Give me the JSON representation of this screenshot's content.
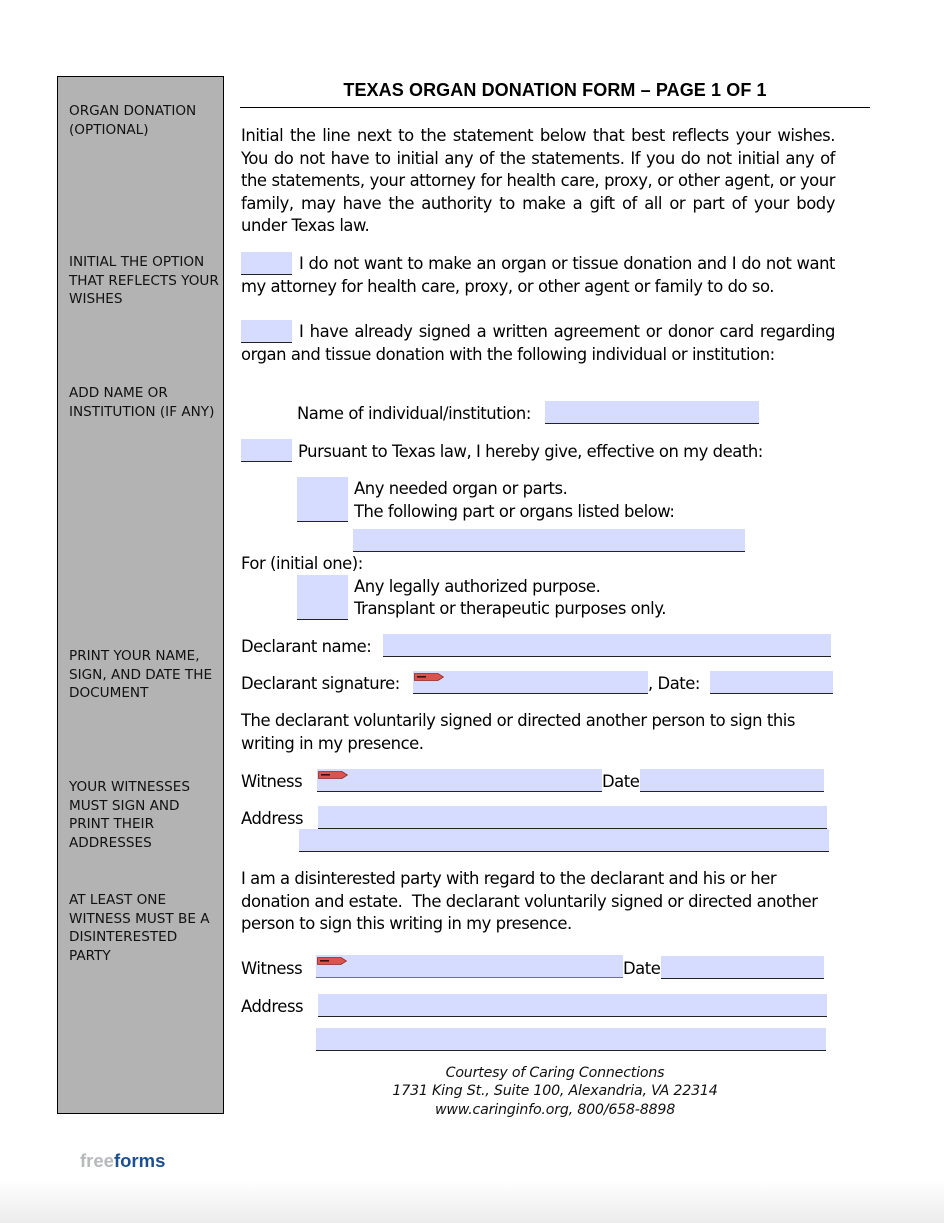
{
  "document": {
    "title": "TEXAS ORGAN DONATION FORM – PAGE 1 OF 1"
  },
  "sidebar": {
    "labels": [
      "ORGAN DONATION (OPTIONAL)",
      "INITIAL THE OPTION THAT REFLECTS YOUR WISHES",
      "ADD NAME OR INSTITUTION (IF ANY)",
      "PRINT YOUR NAME, SIGN, AND DATE THE DOCUMENT",
      "YOUR WITNESSES MUST SIGN AND PRINT THEIR ADDRESSES",
      "AT LEAST ONE WITNESS MUST BE A DISINTERESTED PARTY"
    ]
  },
  "body": {
    "intro": "Initial the line next to the statement below that best reflects your wishes. You do not have to initial any of the statements. If you do not initial any of the statements, your attorney for health care, proxy, or other agent, or your family, may have the authority to make a gift of all or part of your body under Texas law.",
    "option_no_donation": "I do not want to make an organ or tissue donation and I do not want my attorney for health care, proxy, or other agent or family to do so.",
    "option_signed_agreement": "I have already signed a written agreement or donor card regarding organ and tissue donation with the following individual or institution:",
    "name_institution_label": "Name of individual/institution:",
    "option_give": "Pursuant to Texas law, I hereby give, effective on my death:",
    "give_any": "Any needed organ or parts.",
    "give_following": "The following part or organs listed below:",
    "for_label": "For (initial one):",
    "purpose_any": "Any legally authorized purpose.",
    "purpose_transplant": "Transplant or therapeutic purposes only.",
    "declarant_name_label": "Declarant name:",
    "declarant_signature_label": "Declarant signature:",
    "date_label_comma": ", Date:",
    "witness_statement": "The declarant voluntarily signed or directed another person to sign this writing in my presence.",
    "witness_label": "Witness",
    "date_label": "Date",
    "address_label": "Address",
    "disinterested_statement": "I am a disinterested party with regard to the declarant and his or her donation and estate.  The declarant voluntarily signed or directed another person to sign this writing in my presence."
  },
  "fields": {
    "initial_no_donation": "",
    "initial_signed_agreement": "",
    "name_institution": "",
    "initial_give": "",
    "initial_any_organ": "",
    "initial_following_organs": "",
    "organs_list": "",
    "initial_purpose_any": "",
    "initial_purpose_transplant": "",
    "declarant_name": "",
    "declarant_signature": "",
    "declarant_date": "",
    "witness1_signature": "",
    "witness1_date": "",
    "witness1_address_line1": "",
    "witness1_address_line2": "",
    "witness2_signature": "",
    "witness2_date": "",
    "witness2_address_line1": "",
    "witness2_address_line2": ""
  },
  "sign_tag": {
    "label": "SIGN HERE",
    "color": "#d9534f"
  },
  "credit": {
    "line1": "Courtesy of Caring Connections",
    "line2": "1731 King St., Suite 100, Alexandria, VA  22314",
    "line3": "www.caringinfo.org, 800/658-8898"
  },
  "branding": {
    "free": "free",
    "forms": "forms"
  },
  "colors": {
    "sidebar": "#b3b3b3",
    "field": "#d6dcff",
    "logo_blue": "#1e4f8f",
    "logo_gray": "#b7b9bd"
  }
}
